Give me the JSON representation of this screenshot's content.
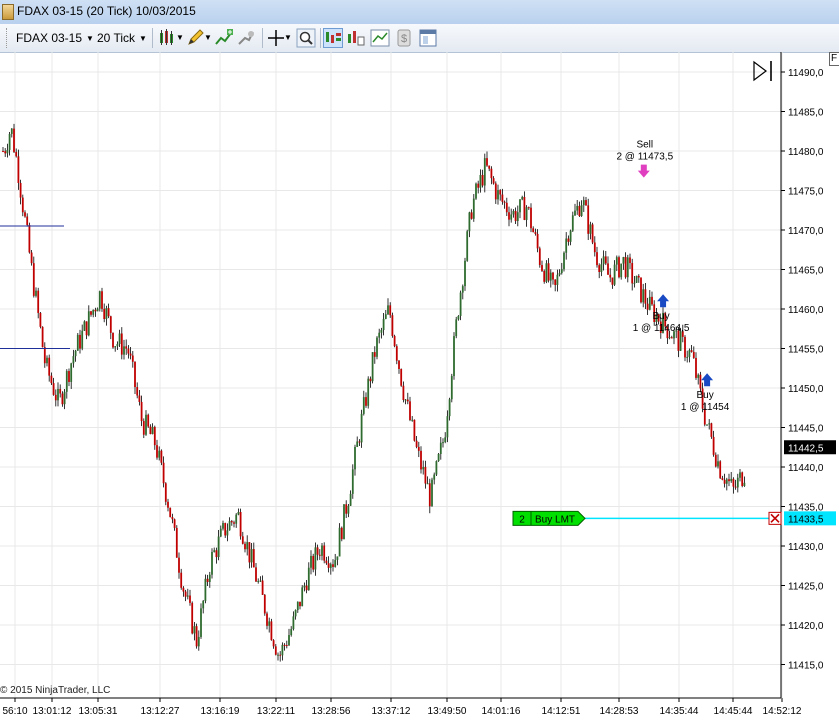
{
  "window": {
    "title": "FDAX 03-15 (20 Tick)  10/03/2015"
  },
  "toolbar": {
    "instrument": "FDAX 03-15",
    "interval": "20 Tick",
    "icons": [
      "bars-icon",
      "pencil-icon",
      "add-indicator-icon",
      "strategy-icon",
      "crosshair-icon",
      "zoom-icon",
      "chart-trader-icon",
      "data-box-icon",
      "money-icon",
      "properties-icon"
    ]
  },
  "corner_label": "F",
  "copyright": "© 2015 NinjaTrader, LLC",
  "colors": {
    "up": "#2f6b2f",
    "down": "#c00000",
    "buy_arrow": "#1a49c4",
    "sell_arrow": "#e040c0",
    "order_line": "#00e5ff",
    "order_tag": "#00e000",
    "price_tag": "#000000"
  },
  "chart_data": {
    "type": "candlestick",
    "ylim": [
      11410,
      11490
    ],
    "ytick_labels": [
      "11490,0",
      "11485,0",
      "11480,0",
      "11475,0",
      "11470,0",
      "11465,0",
      "11460,0",
      "11455,0",
      "11450,0",
      "11445,0",
      "11440,0",
      "11435,0",
      "11430,0",
      "11425,0",
      "11420,0",
      "11415,0"
    ],
    "xtick_labels": [
      "56:10",
      "13:01:12",
      "13:05:31",
      "13:12:27",
      "13:16:19",
      "13:22:11",
      "13:28:56",
      "13:37:12",
      "13:49:50",
      "14:01:16",
      "14:12:51",
      "14:28:53",
      "14:35:44",
      "14:45:44",
      "14:52:12"
    ],
    "price_path": [
      [
        0,
        11480
      ],
      [
        0.5,
        11483
      ],
      [
        1,
        11478
      ],
      [
        2,
        11465
      ],
      [
        3,
        11453
      ],
      [
        4,
        11448
      ],
      [
        5,
        11454
      ],
      [
        6,
        11458
      ],
      [
        7,
        11462
      ],
      [
        8,
        11456
      ],
      [
        9,
        11455
      ],
      [
        10,
        11446
      ],
      [
        11,
        11443
      ],
      [
        12,
        11435
      ],
      [
        13,
        11425
      ],
      [
        14,
        11418
      ],
      [
        15,
        11428
      ],
      [
        16,
        11432
      ],
      [
        17,
        11434
      ],
      [
        18,
        11428
      ],
      [
        19,
        11422
      ],
      [
        20,
        11416
      ],
      [
        21,
        11420
      ],
      [
        22,
        11426
      ],
      [
        23,
        11430
      ],
      [
        24,
        11428
      ],
      [
        25,
        11436
      ],
      [
        26,
        11446
      ],
      [
        27,
        11455
      ],
      [
        28,
        11460
      ],
      [
        29,
        11450
      ],
      [
        30,
        11442
      ],
      [
        31,
        11436
      ],
      [
        32,
        11444
      ],
      [
        33,
        11460
      ],
      [
        34,
        11473
      ],
      [
        35,
        11478
      ],
      [
        36,
        11474
      ],
      [
        37,
        11472
      ],
      [
        38,
        11473
      ],
      [
        39,
        11466
      ],
      [
        40,
        11462
      ],
      [
        41,
        11470
      ],
      [
        42,
        11474
      ],
      [
        43,
        11467
      ],
      [
        44,
        11464
      ],
      [
        45,
        11466
      ],
      [
        46,
        11463
      ],
      [
        47,
        11460
      ],
      [
        48,
        11458
      ],
      [
        49,
        11456
      ],
      [
        50,
        11454
      ],
      [
        51,
        11446
      ],
      [
        52,
        11440
      ],
      [
        53,
        11437
      ],
      [
        54,
        11440
      ]
    ],
    "last_price": "11442,5",
    "order": {
      "quantity": "2",
      "type": "Buy LMT",
      "price": "11433,5",
      "price_value": 11433.5
    },
    "side_lines": [
      11470.5,
      11455.0
    ],
    "executions": [
      {
        "side": "sell",
        "line1": "Sell",
        "line2": "2 @ 11473,5",
        "price": 11476.5,
        "x": 46.5
      },
      {
        "side": "buy",
        "line1": "Buy",
        "line2": "1 @ 11464,5",
        "price": 11462,
        "x": 47.9
      },
      {
        "side": "buy",
        "line1": "Buy",
        "line2": "1 @ 11454",
        "price": 11452,
        "x": 51.1
      }
    ]
  }
}
